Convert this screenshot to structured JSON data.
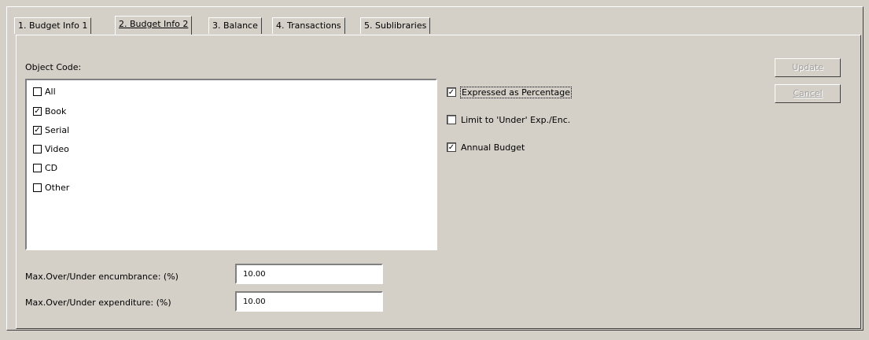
{
  "tabs": [
    "1. Budget Info 1",
    "2. Budget Info 2",
    "3. Balance",
    "4. Transactions",
    "5. Sublibraries"
  ],
  "object_code": {
    "label": "Object Code:",
    "items": [
      {
        "label": "All",
        "checked": false
      },
      {
        "label": "Book",
        "checked": true
      },
      {
        "label": "Serial",
        "checked": true
      },
      {
        "label": "Video",
        "checked": false
      },
      {
        "label": "CD",
        "checked": false
      },
      {
        "label": "Other",
        "checked": false
      }
    ]
  },
  "options": [
    {
      "label": "Expressed as Percentage",
      "checked": true
    },
    {
      "label": "Limit to 'Under' Exp./Enc.",
      "checked": false
    },
    {
      "label": "Annual Budget",
      "checked": true
    }
  ],
  "buttons": {
    "update": "Update",
    "cancel": "Cancel"
  },
  "fields": {
    "encumbrance_label": "Max.Over/Under encumbrance: (%)",
    "encumbrance_value": "10.00",
    "expenditure_label": "Max.Over/Under expenditure: (%)",
    "expenditure_value": "10.00"
  }
}
